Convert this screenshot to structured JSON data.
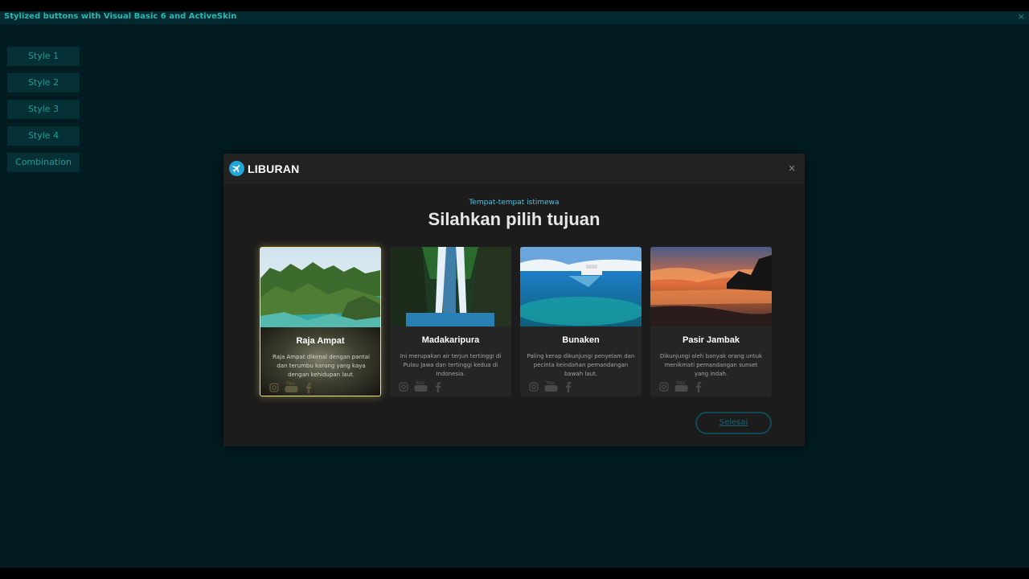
{
  "window": {
    "title": "Stylized buttons with Visual Basic 6 and ActiveSkin",
    "close_glyph": "×"
  },
  "sidebar": {
    "buttons": [
      {
        "label": "Style 1"
      },
      {
        "label": "Style 2"
      },
      {
        "label": "Style 3"
      },
      {
        "label": "Style 4"
      },
      {
        "label": "Combination"
      }
    ]
  },
  "dialog": {
    "brand": "LIBURAN",
    "brand_icon": "airplane-icon",
    "close_glyph": "×",
    "subtitle": "Tempat-tempat istimewa",
    "headline": "Silahkan pilih tujuan",
    "done_label": "Selesai",
    "cards": [
      {
        "title": "Raja Ampat",
        "description": "Raja Ampat dikenal dengan pantai dan terumbu karang yang kaya dengan kehidupan laut.",
        "selected": true
      },
      {
        "title": "Madakaripura",
        "description": "Ini merupakan air terjun tertinggi di Pulau Jawa dan tertinggi kedua di Indonesia.",
        "selected": false
      },
      {
        "title": "Bunaken",
        "description": "Paling kerap dikunjungi penyelam dan pecinta keindahan pemandangan bawah laut.",
        "selected": false
      },
      {
        "title": "Pasir Jambak",
        "description": "Dikunjungi oleh banyak orang untuk menikmati pemandangan sunset yang indah.",
        "selected": false
      }
    ],
    "social_icons": [
      "instagram-icon",
      "youtube-icon",
      "facebook-icon"
    ]
  },
  "colors": {
    "background": "#021c22",
    "accent": "#22a6d8",
    "selected_border": "#f1e58b"
  }
}
